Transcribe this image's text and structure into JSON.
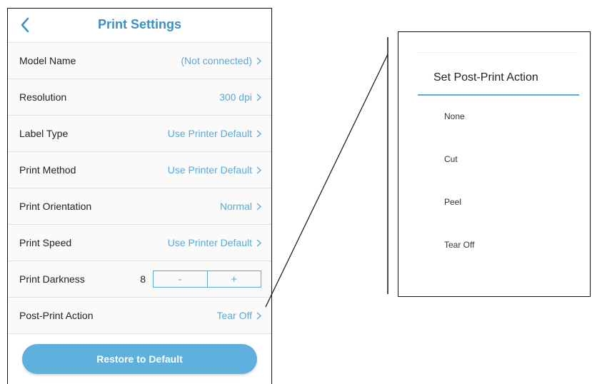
{
  "header": {
    "title": "Print Settings",
    "back_icon": "chevron-left-icon"
  },
  "settings": [
    {
      "label": "Model Name",
      "value": "(Not connected)"
    },
    {
      "label": "Resolution",
      "value": "300 dpi"
    },
    {
      "label": "Label Type",
      "value": "Use Printer Default"
    },
    {
      "label": "Print Method",
      "value": "Use Printer Default"
    },
    {
      "label": "Print Orientation",
      "value": "Normal"
    },
    {
      "label": "Print Speed",
      "value": "Use Printer Default"
    }
  ],
  "darkness": {
    "label": "Print Darkness",
    "value": "8",
    "minus": "-",
    "plus": "+"
  },
  "post_print": {
    "label": "Post-Print Action",
    "value": "Tear Off"
  },
  "restore_button": "Restore to Default",
  "popup": {
    "title": "Set Post-Print Action",
    "options": [
      "None",
      "Cut",
      "Peel",
      "Tear Off"
    ]
  },
  "colors": {
    "accent": "#5aa9d8",
    "title": "#3d8fc4",
    "button": "#5fb0dd"
  }
}
